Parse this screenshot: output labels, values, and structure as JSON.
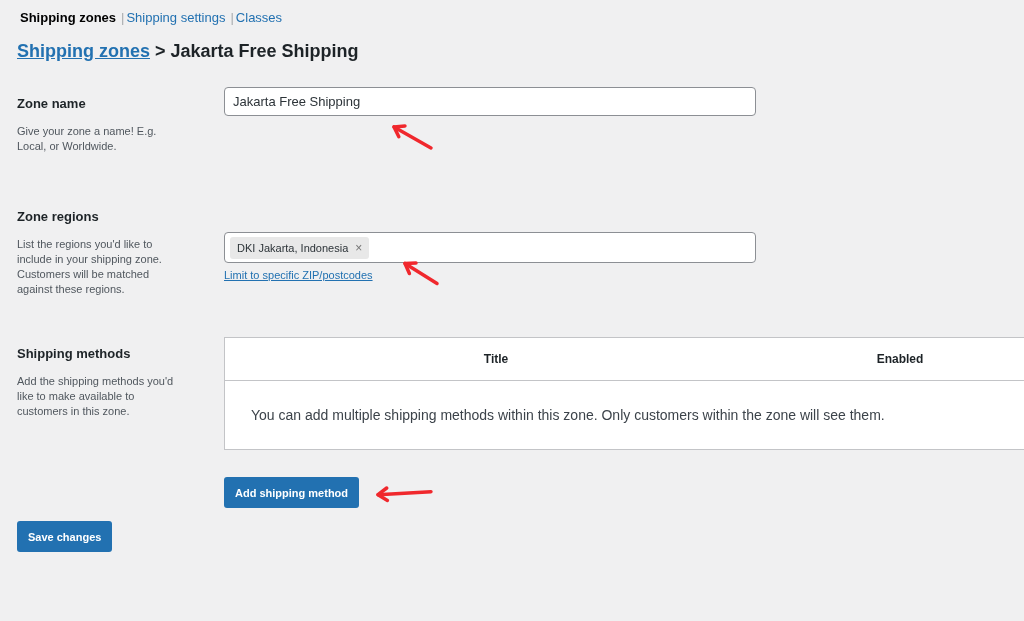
{
  "subnav": [
    {
      "label": "Shipping zones",
      "selected": true
    },
    {
      "label": "Shipping settings",
      "selected": false,
      "separator": "|"
    },
    {
      "label": "Classes",
      "selected": false,
      "separator": "|"
    }
  ],
  "breadcrumb": {
    "link": "Shipping zones",
    "separator": ">",
    "current": "Jakarta Free Shipping"
  },
  "zone_name": {
    "label": "Zone name",
    "description": "Give your zone a name! E.g. Local, or Worldwide.",
    "value": "Jakarta Free Shipping"
  },
  "zone_regions": {
    "label": "Zone regions",
    "description": "List the regions you'd like to include in your shipping zone. Customers will be matched against these regions.",
    "tags": [
      {
        "text": "DKI Jakarta, Indonesia",
        "remove": "×"
      }
    ],
    "link": "Limit to specific ZIP/postcodes"
  },
  "shipping_methods": {
    "label": "Shipping methods",
    "description": "Add the shipping methods you'd like to make available to customers in this zone.",
    "columns": [
      "Title",
      "Enabled"
    ],
    "empty_message": "You can add multiple shipping methods within this zone. Only customers within the zone will see them.",
    "button": "Add shipping method"
  },
  "save_button": "Save changes"
}
